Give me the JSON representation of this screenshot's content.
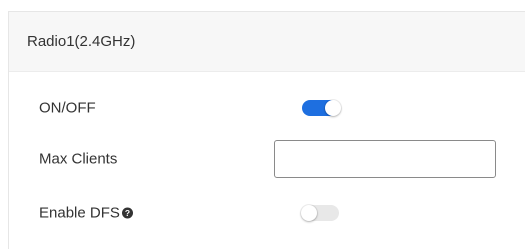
{
  "panel": {
    "title": "Radio1(2.4GHz)"
  },
  "settings": {
    "on_off": {
      "label": "ON/OFF",
      "enabled": true
    },
    "max_clients": {
      "label": "Max Clients",
      "value": "",
      "placeholder": ""
    },
    "enable_dfs": {
      "label": "Enable DFS",
      "enabled": false,
      "help_icon": "question-circle-icon"
    }
  },
  "colors": {
    "toggle_on": "#1e6fe0",
    "toggle_off": "#e8e8e8",
    "header_bg": "#f7f7f7"
  }
}
